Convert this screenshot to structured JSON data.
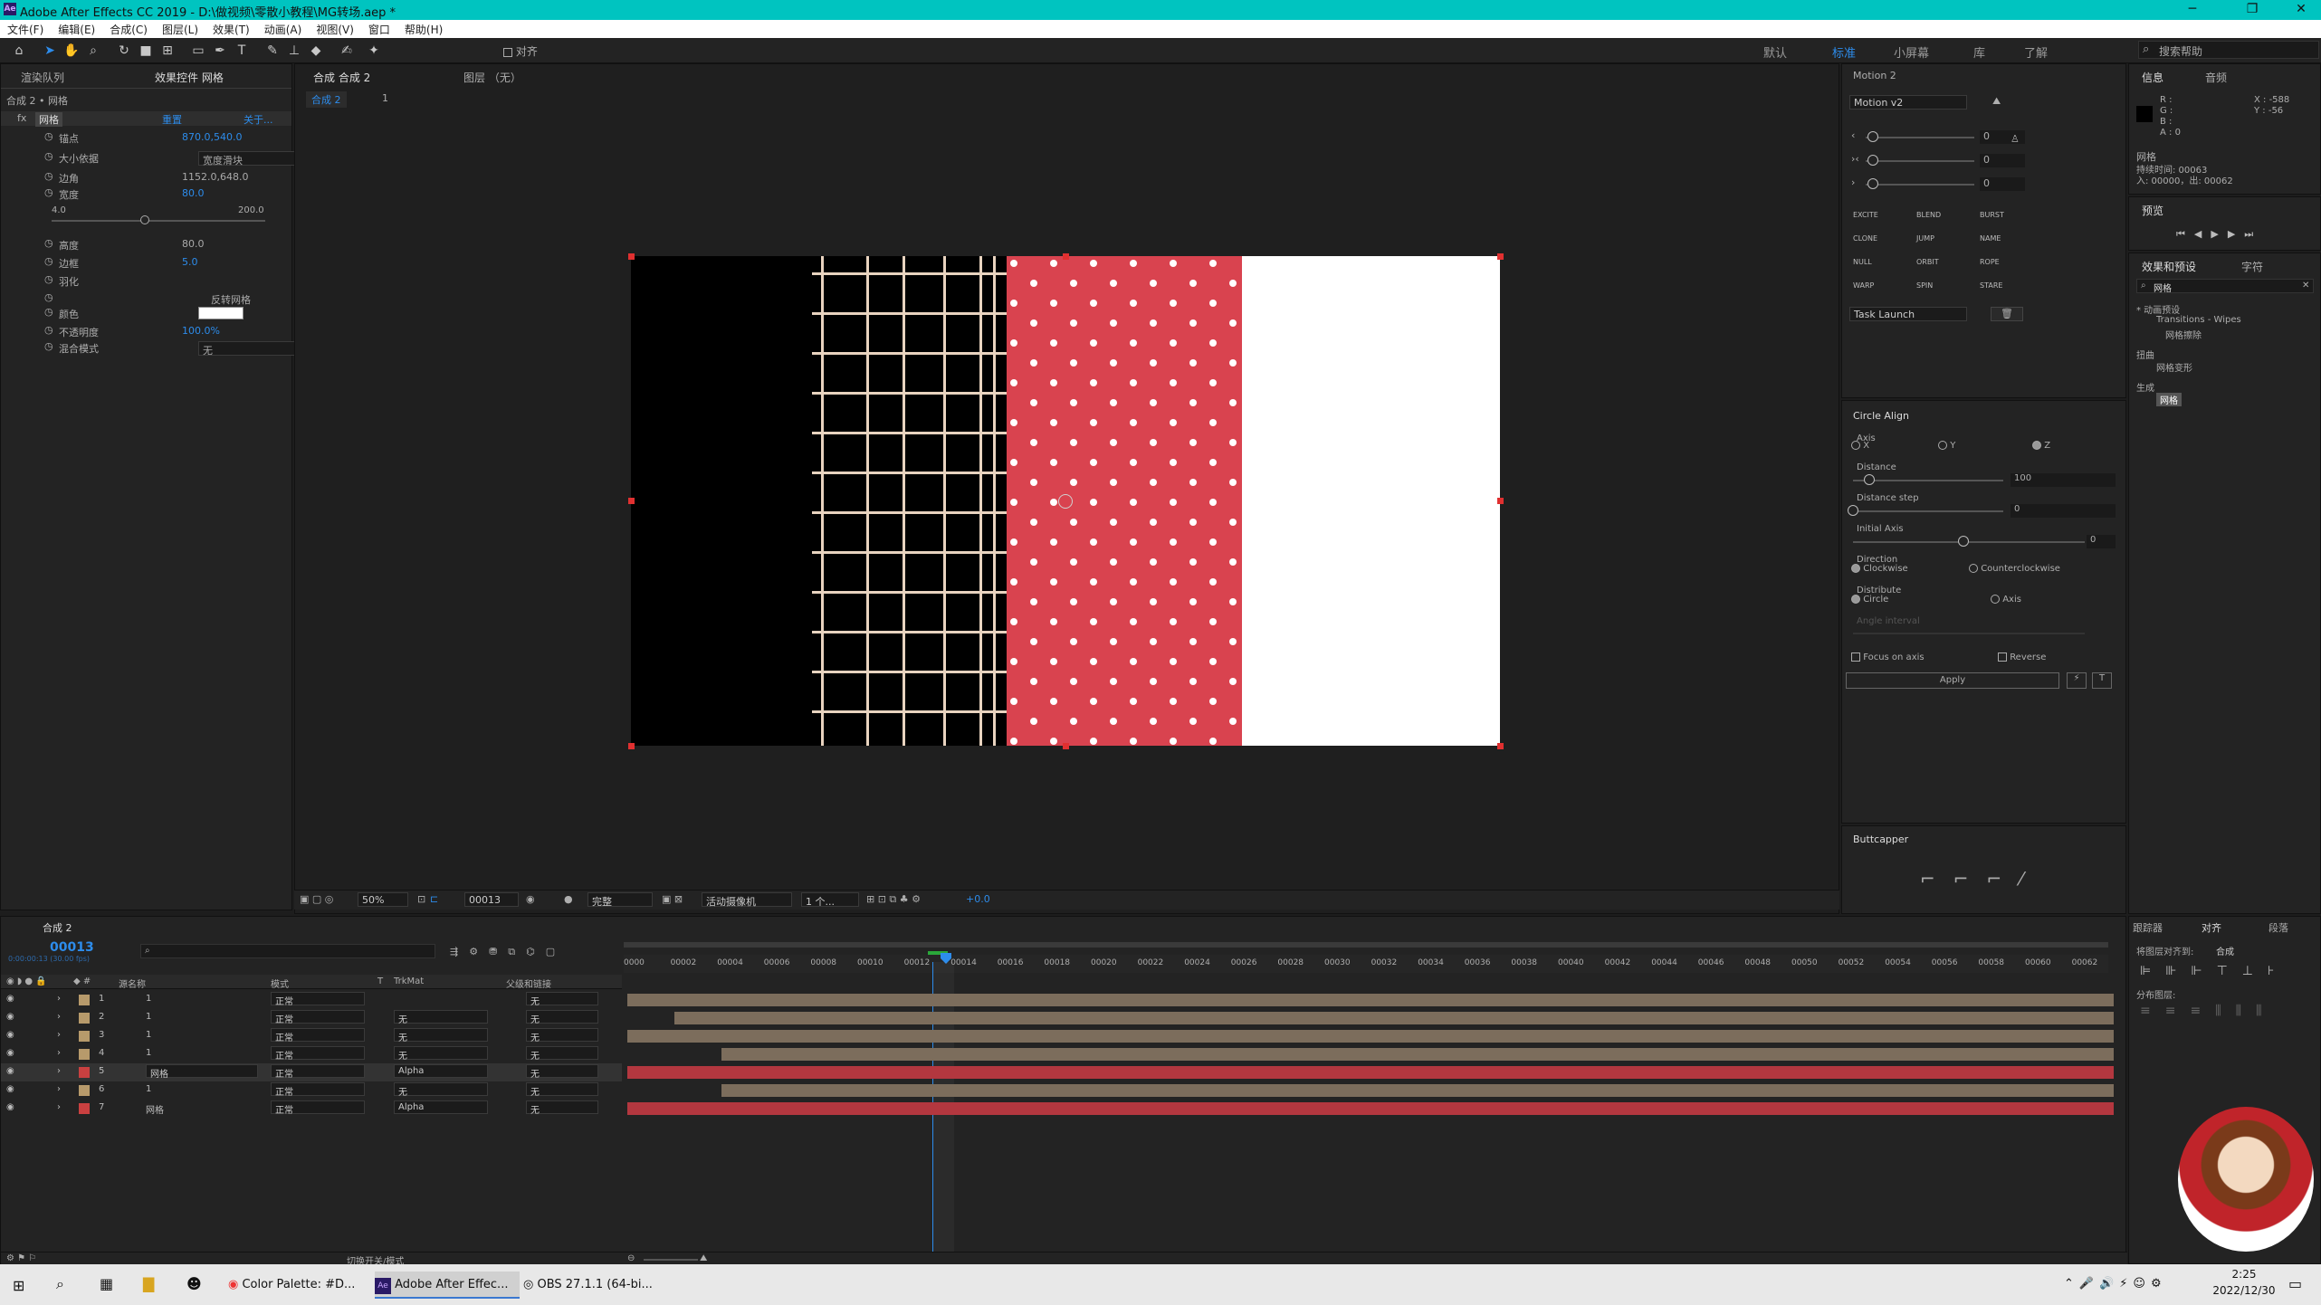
{
  "window": {
    "title": "Adobe After Effects CC 2019 - D:\\做视频\\零散小教程\\MG转场.aep *",
    "minimize": "─",
    "maximize": "❐",
    "close": "✕"
  },
  "menu": [
    "文件(F)",
    "编辑(E)",
    "合成(C)",
    "图层(L)",
    "效果(T)",
    "动画(A)",
    "视图(V)",
    "窗口",
    "帮助(H)"
  ],
  "toolbar": {
    "align_label": "对齐",
    "workspaces": [
      "默认",
      "标准",
      "小屏幕",
      "库",
      "了解"
    ],
    "active_workspace": "标准",
    "search_placeholder": "搜索帮助"
  },
  "effect_controls": {
    "tabs": [
      "渲染队列",
      "效果控件 网格"
    ],
    "breadcrumb": "合成 2 • 网格",
    "effect_name": "网格",
    "reset": "重置",
    "about": "关于...",
    "props": [
      {
        "name": "锚点",
        "value": "870.0,540.0"
      },
      {
        "name": "大小依据",
        "value": "宽度滑块"
      },
      {
        "name": "边角",
        "value": "1152.0,648.0"
      },
      {
        "name": "宽度",
        "value": "80.0"
      },
      {
        "name": "高度",
        "value": "80.0"
      },
      {
        "name": "边框",
        "value": "5.0"
      },
      {
        "name": "羽化",
        "value": ""
      },
      {
        "name": "",
        "value": "反转网格"
      },
      {
        "name": "颜色",
        "value": ""
      },
      {
        "name": "不透明度",
        "value": "100.0%"
      },
      {
        "name": "混合模式",
        "value": "无"
      }
    ],
    "slider_min": "4.0",
    "slider_max": "200.0"
  },
  "viewer": {
    "tabs": [
      "合成 合成 2",
      "图层 （无）"
    ],
    "breadcrumb": "合成 2",
    "breadcrumb_sub": "1",
    "zoom": "50%",
    "timecode": "00013",
    "quality": "完整",
    "camera": "活动摄像机",
    "views": "1 个...",
    "exposure": "+0.0"
  },
  "motion": {
    "title": "Motion 2",
    "preset": "Motion v2",
    "values": [
      "0",
      "0",
      "0"
    ],
    "buttons": [
      "EXCITE",
      "BLEND",
      "BURST",
      "CLONE",
      "JUMP",
      "NAME",
      "NULL",
      "ORBIT",
      "ROPE",
      "WARP",
      "SPIN",
      "STARE"
    ],
    "task": "Task Launch"
  },
  "circle_align": {
    "title": "Circle Align",
    "axis_label": "Axis",
    "axis_options": [
      "X",
      "Y",
      "Z"
    ],
    "distance_label": "Distance",
    "distance_value": "100",
    "distance_step_label": "Distance step",
    "distance_step_value": "0",
    "initial_axis_label": "Initial Axis",
    "initial_axis_value": "0",
    "direction_label": "Direction",
    "clockwise": "Clockwise",
    "counterclockwise": "Counterclockwise",
    "distribute_label": "Distribute",
    "circle": "Circle",
    "axis": "Axis",
    "angle_interval": "Angle interval",
    "focus_on_axis": "Focus on axis",
    "reverse": "Reverse",
    "apply": "Apply"
  },
  "buttcapper": {
    "title": "Buttcapper"
  },
  "info": {
    "tabs": [
      "信息",
      "音频"
    ],
    "rgb": [
      "R :",
      "G :",
      "B :",
      "A : 0"
    ],
    "xy": [
      "X : -588",
      "Y : -56"
    ],
    "layer_name": "网格",
    "duration": "持续时间: 00063",
    "in_out": "入: 00000，出: 00062"
  },
  "preview": {
    "title": "预览"
  },
  "effects_presets": {
    "tabs": [
      "效果和预设",
      "字符"
    ],
    "search_value": "网格",
    "tree": [
      "* 动画预设",
      "Transitions - Wipes",
      "网格擦除",
      "扭曲",
      "网格变形",
      "生成",
      "网格"
    ]
  },
  "timeline": {
    "tab": "合成 2",
    "timecode": "00013",
    "timecode_sub": "0:00:00:13 (30.00 fps)",
    "search_placeholder": "",
    "headers": [
      "源名称",
      "模式",
      "T",
      "TrkMat",
      "父级和链接"
    ],
    "layers": [
      {
        "num": "1",
        "name": "1",
        "mode": "正常",
        "trkmat": "",
        "parent": "无",
        "color": "#b79a6b"
      },
      {
        "num": "2",
        "name": "1",
        "mode": "正常",
        "trkmat": "无",
        "parent": "无",
        "color": "#b79a6b"
      },
      {
        "num": "3",
        "name": "1",
        "mode": "正常",
        "trkmat": "无",
        "parent": "无",
        "color": "#b79a6b"
      },
      {
        "num": "4",
        "name": "1",
        "mode": "正常",
        "trkmat": "无",
        "parent": "无",
        "color": "#b79a6b"
      },
      {
        "num": "5",
        "name": "网格",
        "mode": "正常",
        "trkmat": "Alpha",
        "parent": "无",
        "color": "#c94040"
      },
      {
        "num": "6",
        "name": "1",
        "mode": "正常",
        "trkmat": "无",
        "parent": "无",
        "color": "#b79a6b"
      },
      {
        "num": "7",
        "name": "网格",
        "mode": "正常",
        "trkmat": "Alpha",
        "parent": "无",
        "color": "#c94040"
      }
    ],
    "ticks": [
      "0000",
      "00002",
      "00004",
      "00006",
      "00008",
      "00010",
      "00012",
      "00014",
      "00016",
      "00018",
      "00020",
      "00022",
      "00024",
      "00026",
      "00028",
      "00030",
      "00032",
      "00034",
      "00036",
      "00038",
      "00040",
      "00042",
      "00044",
      "00046",
      "00048",
      "00050",
      "00052",
      "00054",
      "00056",
      "00058",
      "00060",
      "00062"
    ],
    "footer": "切换开关/模式"
  },
  "align_panel": {
    "tabs": [
      "跟踪器",
      "对齐",
      "段落"
    ],
    "align_to_label": "将图层对齐到:",
    "align_to_value": "合成",
    "distribute_label": "分布图层:"
  },
  "taskbar": {
    "items": [
      "Color Palette: #D...",
      "Adobe After Effec...",
      "OBS 27.1.1 (64-bi..."
    ],
    "time": "2:25",
    "date": "2022/12/30"
  },
  "colors": {
    "accent": "#2d8ceb",
    "titlebar": "#00c4c0",
    "comp_red": "#d9434f"
  }
}
